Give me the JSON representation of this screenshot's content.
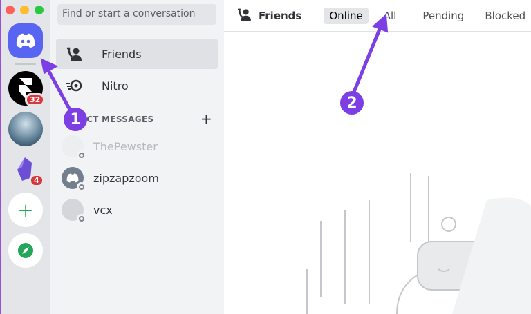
{
  "sidebar": {
    "search_placeholder": "Find or start a conversation",
    "nav": [
      {
        "label": "Friends",
        "icon": "friends-icon"
      },
      {
        "label": "Nitro",
        "icon": "nitro-icon"
      }
    ],
    "dm_header": "DIRECT MESSAGES",
    "dm_add": "+",
    "dms": [
      {
        "name": "ThePewster"
      },
      {
        "name": "zipzapzoom"
      },
      {
        "name": "vcx"
      }
    ]
  },
  "servers": [
    {
      "badge": "32"
    },
    {
      "badge": ""
    },
    {
      "badge": "4"
    }
  ],
  "header": {
    "title": "Friends",
    "tabs": [
      "Online",
      "All",
      "Pending",
      "Blocked"
    ],
    "selected": "Online"
  },
  "annotations": [
    "1",
    "2"
  ],
  "colors": {
    "accent": "#5865f2",
    "annotation": "#7b3fe4",
    "badge": "#da373c",
    "green": "#23a55a"
  }
}
